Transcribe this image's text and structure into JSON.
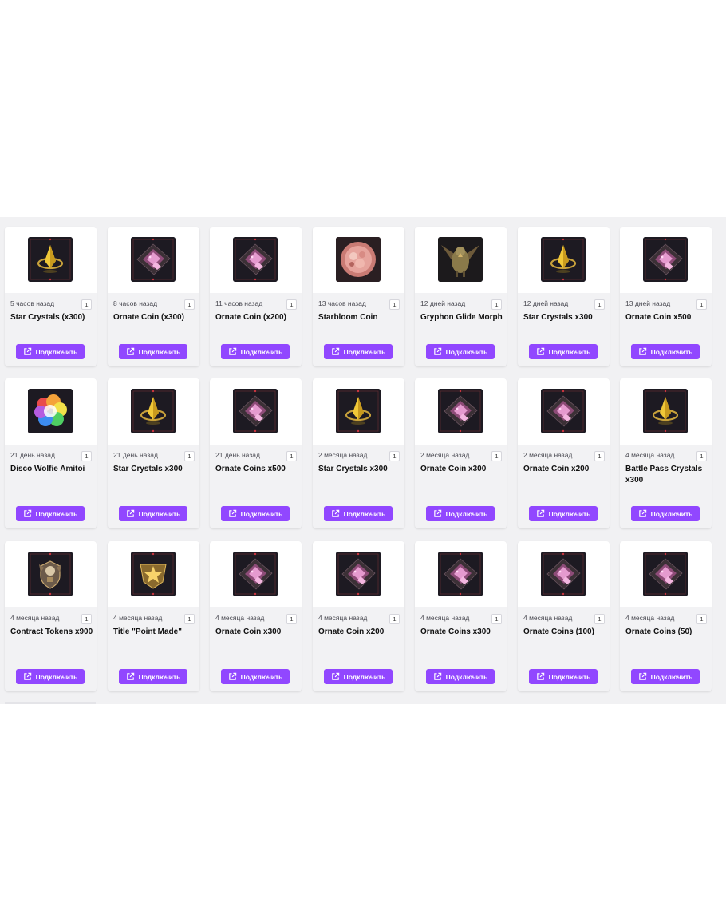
{
  "button_label": "Подключить",
  "accent_color": "#9147ff",
  "rows": [
    [
      {
        "time": "5 часов назад",
        "qty": "1",
        "title": "Star Crystals (x300)",
        "icon": "star-crystal-icon"
      },
      {
        "time": "8 часов назад",
        "qty": "1",
        "title": "Ornate Coin (x300)",
        "icon": "ornate-coin-icon"
      },
      {
        "time": "11 часов назад",
        "qty": "1",
        "title": "Ornate Coin (x200)",
        "icon": "ornate-coin-icon"
      },
      {
        "time": "13 часов назад",
        "qty": "1",
        "title": "Starbloom Coin",
        "icon": "starbloom-coin-icon"
      },
      {
        "time": "12 дней назад",
        "qty": "1",
        "title": "Gryphon Glide Morph",
        "icon": "gryphon-icon"
      },
      {
        "time": "12 дней назад",
        "qty": "1",
        "title": "Star Crystals x300",
        "icon": "star-crystal-icon"
      },
      {
        "time": "13 дней назад",
        "qty": "1",
        "title": "Ornate Coin x500",
        "icon": "ornate-coin-icon"
      }
    ],
    [
      {
        "time": "21 день назад",
        "qty": "1",
        "title": "Disco Wolfie Amitoi",
        "icon": "disco-wolfie-icon"
      },
      {
        "time": "21 день назад",
        "qty": "1",
        "title": "Star Crystals x300",
        "icon": "star-crystal-icon"
      },
      {
        "time": "21 день назад",
        "qty": "1",
        "title": "Ornate Coins x500",
        "icon": "ornate-coin-icon"
      },
      {
        "time": "2 месяца назад",
        "qty": "1",
        "title": "Star Crystals x300",
        "icon": "star-crystal-icon"
      },
      {
        "time": "2 месяца назад",
        "qty": "1",
        "title": "Ornate Coin x300",
        "icon": "ornate-coin-icon"
      },
      {
        "time": "2 месяца назад",
        "qty": "1",
        "title": "Ornate Coin x200",
        "icon": "ornate-coin-icon"
      },
      {
        "time": "4 месяца назад",
        "qty": "1",
        "title": "Battle Pass Crystals x300",
        "icon": "star-crystal-icon"
      }
    ],
    [
      {
        "time": "4 месяца назад",
        "qty": "1",
        "title": "Contract Tokens x900",
        "icon": "contract-token-icon"
      },
      {
        "time": "4 месяца назад",
        "qty": "1",
        "title": "Title \"Point Made\"",
        "icon": "title-badge-icon"
      },
      {
        "time": "4 месяца назад",
        "qty": "1",
        "title": "Ornate Coin x300",
        "icon": "ornate-coin-icon"
      },
      {
        "time": "4 месяца назад",
        "qty": "1",
        "title": "Ornate Coin x200",
        "icon": "ornate-coin-icon"
      },
      {
        "time": "4 месяца назад",
        "qty": "1",
        "title": "Ornate Coins x300",
        "icon": "ornate-coin-icon"
      },
      {
        "time": "4 месяца назад",
        "qty": "1",
        "title": "Ornate Coins (100)",
        "icon": "ornate-coin-icon"
      },
      {
        "time": "4 месяца назад",
        "qty": "1",
        "title": "Ornate Coins (50)",
        "icon": "ornate-coin-icon"
      }
    ]
  ]
}
